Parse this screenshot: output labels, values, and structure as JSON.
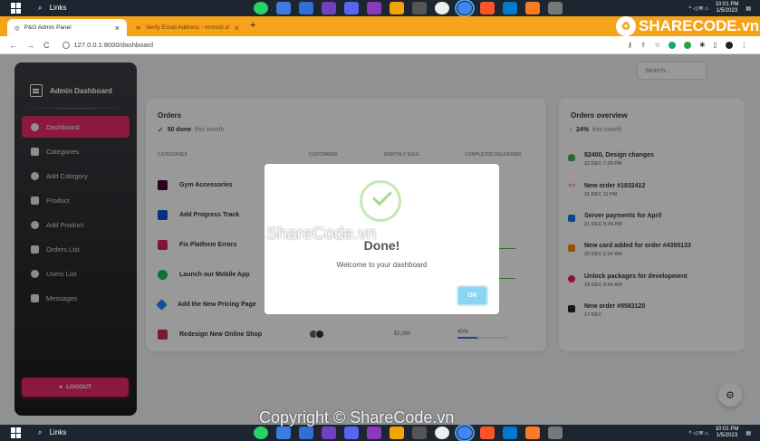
{
  "taskbar": {
    "search_label": "Links",
    "time": "10:01 PM",
    "date": "1/5/2023"
  },
  "browser": {
    "active_tab": "P&G Admin Panel",
    "inactive_tab": "Verify Email Address - mrmoiz.d",
    "new_tab": "+",
    "url": "127.0.0.1:8000/dashboard"
  },
  "sidebar": {
    "brand": "Admin Dashboard",
    "items": [
      {
        "label": "Dashboard"
      },
      {
        "label": "Categories"
      },
      {
        "label": "Add Category"
      },
      {
        "label": "Product"
      },
      {
        "label": "Add Product"
      },
      {
        "label": "Orders List"
      },
      {
        "label": "Users List"
      },
      {
        "label": "Messages"
      }
    ],
    "logout": "LOGOUT"
  },
  "search": {
    "placeholder": "Search..."
  },
  "orders": {
    "title": "Orders",
    "done_count": "50 done",
    "done_suffix": "this month",
    "columns": [
      "CATEGORIES",
      "CUSTOMERS",
      "MONTHLY SALE",
      "COMPLETED DELIVERIES"
    ],
    "rows": [
      {
        "name": "Gym Accessories",
        "icon_color": "#470137"
      },
      {
        "name": "Add Progress Track",
        "icon_color": "#0a4fd6"
      },
      {
        "name": "Fix Platform Errors",
        "icon_color": "#e01e5a"
      },
      {
        "name": "Launch our Mobile App",
        "icon_color": "#1db954"
      },
      {
        "name": "Add the New Pricing Page",
        "icon_color": "#2684ff"
      },
      {
        "name": "Redesign New Online Shop",
        "icon_color": "#c4314b",
        "budget": "$2,000",
        "progress": "40%",
        "progress_value": 40
      }
    ]
  },
  "overview": {
    "title": "Orders overview",
    "growth": "24%",
    "growth_suffix": "this month",
    "items": [
      {
        "title": "$2400, Design changes",
        "date": "22 DEC 7:20 PM",
        "color": "#4caf50"
      },
      {
        "title": "New order #1832412",
        "date": "21 DEC 11 PM",
        "color": "#f44335"
      },
      {
        "title": "Server payments for April",
        "date": "21 DEC 9:34 PM",
        "color": "#1a73e8"
      },
      {
        "title": "New card added for order #4395133",
        "date": "20 DEC 2:20 AM",
        "color": "#fb8c00"
      },
      {
        "title": "Unlock packages for development",
        "date": "18 DEC 4:54 AM",
        "color": "#e91e63"
      },
      {
        "title": "New order #9583120",
        "date": "17 DEC",
        "color": "#262626"
      }
    ]
  },
  "modal": {
    "title": "Done!",
    "text": "Welcome to your dashboard",
    "ok": "OK"
  },
  "watermark": {
    "logo": "SHARECODE.vn",
    "center": "ShareCode.vn",
    "bottom": "Copyright © ShareCode.vn"
  }
}
